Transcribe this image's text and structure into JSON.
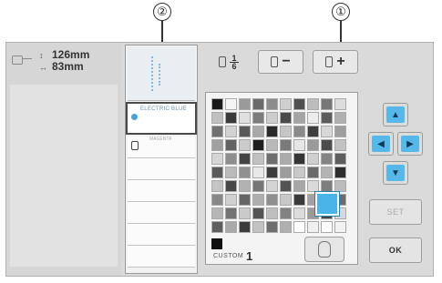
{
  "callouts": {
    "one": "①",
    "two": "②"
  },
  "size_info": {
    "width": "126mm",
    "height": "83mm",
    "width_arrow": "↕",
    "height_arrow": "↔"
  },
  "stitch_order": {
    "selected_name": "ELECTRIC BLUE",
    "other_name": "MAGENTA",
    "swatch_color": "#4aa3d8"
  },
  "toolbar": {
    "fraction_top": "1",
    "fraction_bottom": "6",
    "minus_label": "−",
    "plus_label": "+"
  },
  "palette": {
    "label": "CUSTOM",
    "number": "1",
    "cursor_color": "#4ab3e8",
    "rows": [
      [
        "#1a1a1a",
        "#f4f4f4",
        "#9a9a9a",
        "#6a6a6a",
        "#8c8c8c",
        "#cfcfcf",
        "#505050",
        "#bdbdbd",
        "#777777",
        "#dddddd"
      ],
      [
        "#bfbfbf",
        "#3a3a3a",
        "#e0e0e0",
        "#7c7c7c",
        "#cccccc",
        "#4a4a4a",
        "#a4a4a4",
        "#ececec",
        "#5c5c5c",
        "#b0b0b0"
      ],
      [
        "#707070",
        "#d2d2d2",
        "#5a5a5a",
        "#a8a8a8",
        "#2a2a2a",
        "#c6c6c6",
        "#8a8a8a",
        "#3e3e3e",
        "#d8d8d8",
        "#9e9e9e"
      ],
      [
        "#a0a0a0",
        "#626262",
        "#cbcbcb",
        "#1f1f1f",
        "#b8b8b8",
        "#7a7a7a",
        "#e6e6e6",
        "#9a9a9a",
        "#4c4c4c",
        "#c2c2c2"
      ],
      [
        "#d6d6d6",
        "#8e8e8e",
        "#444444",
        "#c0c0c0",
        "#6e6e6e",
        "#ababab",
        "#353535",
        "#cfcfcf",
        "#848484",
        "#5e5e5e"
      ],
      [
        "#5a5a5a",
        "#bababa",
        "#909090",
        "#e8e8e8",
        "#3c3c3c",
        "#9c9c9c",
        "#c8c8c8",
        "#6a6a6a",
        "#b4b4b4",
        "#2e2e2e"
      ],
      [
        "#c4c4c4",
        "#484848",
        "#b2b2b2",
        "#767676",
        "#d4d4d4",
        "#525252",
        "#a6a6a6",
        "#dadada",
        "#7e7e7e",
        "#bcbcbc"
      ],
      [
        "#888888",
        "#d0d0d0",
        "#666666",
        "#aeaeae",
        "#8f8f8f",
        "#c8c8c8",
        "#3a3a3a",
        "#a2a2a2",
        "#e2e2e2",
        "#6c6c6c"
      ],
      [
        "#b6b6b6",
        "#727272",
        "#cacaca",
        "#545454",
        "#bebebe",
        "#828282",
        "#dcdcdc",
        "#9a9a9a",
        "#464646",
        "#d8d8d8"
      ],
      [
        "#5e5e5e",
        "#a8a8a8",
        "#3c3c3c",
        "#c2c2c2",
        "#6e6e6e",
        "#b0b0b0",
        "#ffffff",
        "#f0f0f0",
        "#ffffff",
        "#f2f2f2"
      ]
    ]
  },
  "controls": {
    "up": "▲",
    "left": "◀",
    "right": "▶",
    "down": "▼",
    "set_label": "SET",
    "ok_label": "OK"
  }
}
